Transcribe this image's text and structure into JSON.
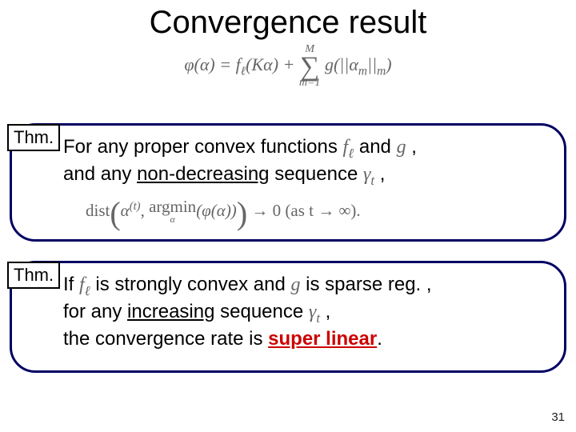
{
  "title": "Convergence result",
  "eq": {
    "lhs": "φ(α) = f",
    "ell": "ℓ",
    "karg": "(Kα) + ",
    "sumTop": "M",
    "sumBot": "m=1",
    "tail": " g(||α",
    "sub_m1": "m",
    "tail2": "||",
    "sub_m2": "m",
    "tail3": ")"
  },
  "thmLabel": "Thm.",
  "thm1": {
    "pre": "For any proper convex functions ",
    "f": "f",
    "ell": "ℓ",
    "and1": " and ",
    "g": "g",
    "comma": " ,",
    "line2a": "and any ",
    "nondec": "non-decreasing",
    "line2b": " sequence ",
    "gamma": "γ",
    "t": "t",
    "line2c": " ,",
    "dist": "dist",
    "alpha_t": "α",
    "t_exp": "(t)",
    "argmin": "argmin",
    "alpha": "α",
    "phi": "(φ(α))",
    "to0": " → 0   (as t → ∞)."
  },
  "thm2": {
    "if": "If ",
    "f": "f",
    "ell": "ℓ",
    "mid1": " is strongly convex and ",
    "g": "g",
    "mid2": " is sparse reg. ,",
    "line2a": "for any ",
    "increasing": "increasing",
    "line2b": " sequence ",
    "gamma": "γ",
    "t": "t",
    "line2c": " ,",
    "line3a": "the convergence rate is ",
    "superlinear": "super linear",
    "line3b": "."
  },
  "pagenum": "31"
}
